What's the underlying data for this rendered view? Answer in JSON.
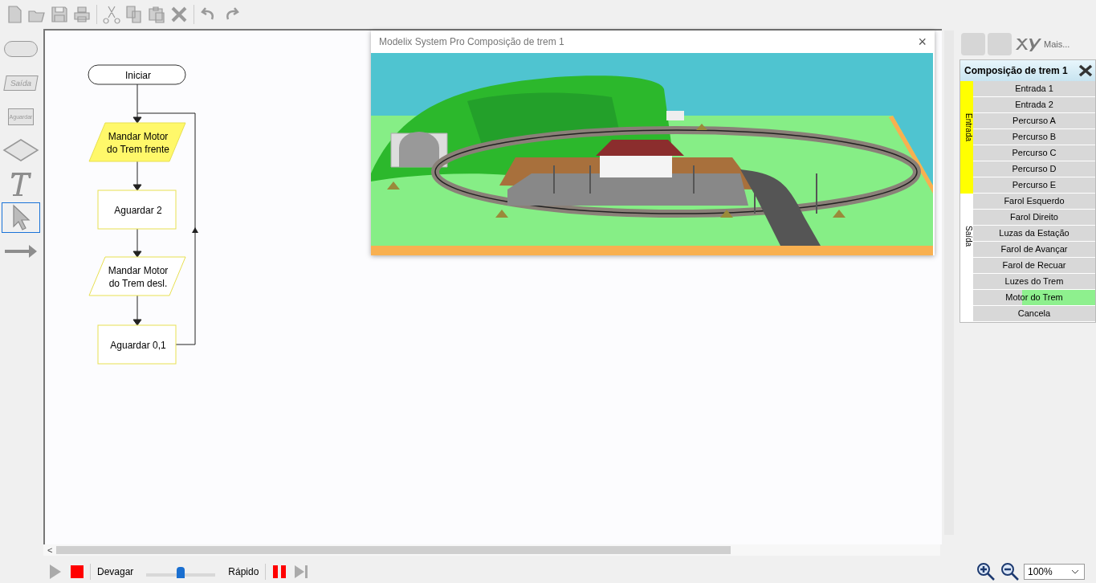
{
  "toolbar": {
    "buttons": [
      {
        "kind": "new"
      },
      {
        "kind": "open"
      },
      {
        "kind": "save"
      },
      {
        "kind": "print"
      },
      {
        "kind": "sep"
      },
      {
        "kind": "cut"
      },
      {
        "kind": "copy"
      },
      {
        "kind": "paste"
      },
      {
        "kind": "delete"
      },
      {
        "kind": "sep"
      },
      {
        "kind": "undo"
      },
      {
        "kind": "redo"
      }
    ]
  },
  "palette": [
    {
      "kind": "terminal",
      "selected": false
    },
    {
      "kind": "output",
      "label": "Saída",
      "selected": false
    },
    {
      "kind": "wait",
      "label": "Aguardar",
      "selected": false
    },
    {
      "kind": "decision",
      "selected": false
    },
    {
      "kind": "text",
      "selected": false
    },
    {
      "kind": "pointer",
      "selected": true
    },
    {
      "kind": "arrow",
      "selected": false
    }
  ],
  "flowchart": {
    "nodes": [
      {
        "kind": "terminal",
        "lines": [
          "Iniciar"
        ],
        "active": false
      },
      {
        "kind": "output",
        "lines": [
          "Mandar Motor",
          "do Trem frente"
        ],
        "active": true
      },
      {
        "kind": "wait",
        "lines": [
          "Aguardar 2"
        ],
        "active": false
      },
      {
        "kind": "output",
        "lines": [
          "Mandar Motor",
          "do Trem desl."
        ],
        "active": false
      },
      {
        "kind": "wait",
        "lines": [
          "Aguardar 0,1"
        ],
        "active": false
      }
    ]
  },
  "window": {
    "title": "Modelix System Pro Composição de trem 1",
    "close": "×"
  },
  "panel": {
    "more": "Mais...",
    "title": "Composição de trem 1",
    "groups": [
      {
        "label": "Entrada",
        "color": "#ffff00",
        "items": [
          {
            "label": "Entrada 1",
            "on": false
          },
          {
            "label": "Entrada 2",
            "on": false
          },
          {
            "label": "Percurso A",
            "on": false
          },
          {
            "label": "Percurso B",
            "on": false
          },
          {
            "label": "Percurso C",
            "on": false
          },
          {
            "label": "Percurso D",
            "on": false
          },
          {
            "label": "Percurso E",
            "on": false
          }
        ]
      },
      {
        "label": "Saída",
        "color": "#ffffff",
        "items": [
          {
            "label": "Farol Esquerdo",
            "on": false
          },
          {
            "label": "Farol Direito",
            "on": false
          },
          {
            "label": "Luzas da Estação",
            "on": false
          },
          {
            "label": "Farol de Avançar",
            "on": false
          },
          {
            "label": "Farol de Recuar",
            "on": false
          },
          {
            "label": "Luzes do Trem",
            "on": false
          },
          {
            "label": "Motor do Trem",
            "on": true
          },
          {
            "label": "Cancela",
            "on": false
          }
        ]
      }
    ]
  },
  "scroll": {
    "left": "<"
  },
  "playback": {
    "slow": "Devagar",
    "fast": "Rápido",
    "speed": {
      "level": 0.5
    }
  },
  "zoom": {
    "value": "100%"
  }
}
